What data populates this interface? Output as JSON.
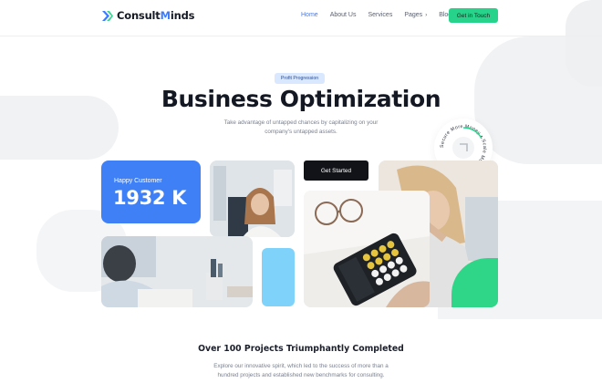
{
  "brand": {
    "name_part1": "Consult",
    "name_part2": "M",
    "name_part3": "inds",
    "accent_color": "#3d7bfa"
  },
  "nav": {
    "items": [
      {
        "label": "Home",
        "active": true
      },
      {
        "label": "About Us",
        "active": false
      },
      {
        "label": "Services",
        "active": false
      },
      {
        "label": "Pages",
        "active": false,
        "caret": "›"
      },
      {
        "label": "Blog",
        "active": false
      }
    ],
    "cta": "Get in Touch",
    "cta_color": "#27d38a"
  },
  "hero": {
    "tag": "Profit Progression",
    "title": "Business Optimization",
    "subtitle": "Take advantage of untapped chances by capitalizing on your company's untapped assets.",
    "badge_text": "Secure More Money • Scale Money •",
    "cta": "Get Started"
  },
  "stats": {
    "label": "Happy Customer",
    "value": "1932 K",
    "color": "#3f80f7"
  },
  "images": [
    {
      "name": "office-woman-photo"
    },
    {
      "name": "meeting-photo"
    },
    {
      "name": "calculator-photo"
    },
    {
      "name": "thinking-woman-photo"
    }
  ],
  "section": {
    "title": "Over 100 Projects Triumphantly Completed",
    "text": "Explore our innovative spirit, which led to the success of more than a hundred projects and established new benchmarks for consulting."
  }
}
